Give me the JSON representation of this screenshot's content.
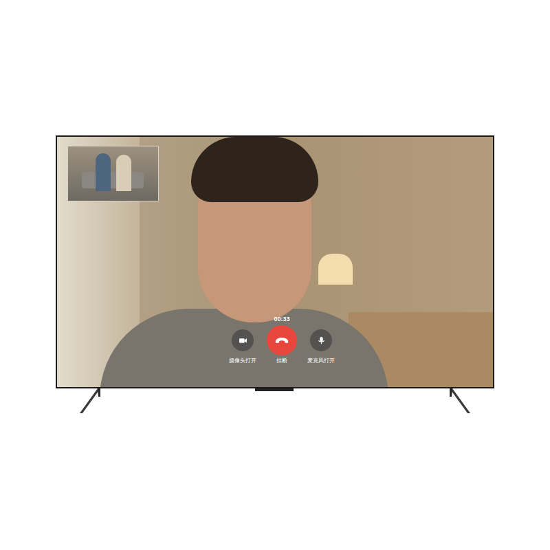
{
  "call": {
    "timer": "00:33",
    "controls": [
      {
        "label": "摄像头打开",
        "kind": "camera"
      },
      {
        "label": "挂断",
        "kind": "hangup"
      },
      {
        "label": "麦克风打开",
        "kind": "mic"
      }
    ]
  }
}
